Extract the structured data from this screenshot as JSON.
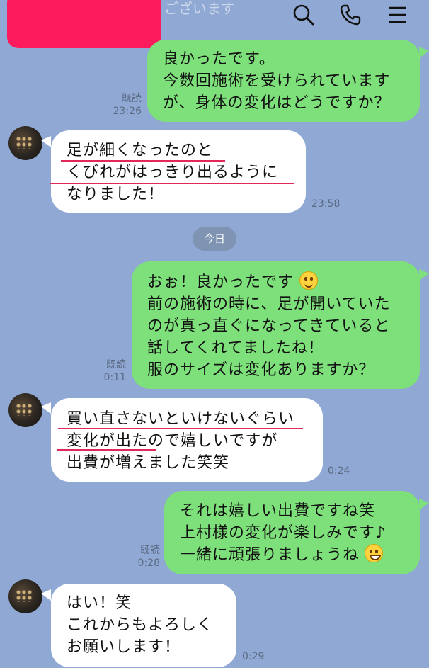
{
  "header": {
    "faded_text": "ございます",
    "icons": [
      "search-icon",
      "phone-icon",
      "menu-icon"
    ]
  },
  "messages": {
    "m1": {
      "side": "me",
      "lines": [
        "良かったです。",
        "今数回施術を受けられています",
        "が、身体の変化はどうですか？"
      ],
      "read": "既読",
      "time": "23:26"
    },
    "m2": {
      "side": "them",
      "lines": [
        "足が細くなったのと",
        "くびれがはっきり出るように",
        "なりました！"
      ],
      "time": "23:58"
    },
    "date_separator": "今日",
    "m3": {
      "side": "me",
      "lines": [
        "おぉ！良かったです",
        "前の施術の時に、足が開いていた",
        "のが真っ直ぐになってきていると",
        "話してくれてましたね！",
        "服のサイズは変化ありますか？"
      ],
      "read": "既読",
      "time": "0:11",
      "emoji": "smiling-face-emoji"
    },
    "m4": {
      "side": "them",
      "lines": [
        "買い直さないといけないぐらい",
        "変化が出たので嬉しいですが",
        "出費が増えました笑笑"
      ],
      "time": "0:24"
    },
    "m5": {
      "side": "me",
      "lines": [
        "それは嬉しい出費ですね笑",
        "上村様の変化が楽しみです♪",
        "一緒に頑張りましょうね"
      ],
      "read": "既読",
      "time": "0:28",
      "emoji": "grinning-face-emoji"
    },
    "m6": {
      "side": "them",
      "lines": [
        "はい！笑",
        "これからもよろしく",
        "お願いします！"
      ],
      "time": "0:29"
    }
  },
  "colors": {
    "background": "#8fa8d4",
    "my_bubble": "#7ee07a",
    "their_bubble": "#ffffff",
    "underline": "#e0285a",
    "redaction": "#fd1b5e"
  }
}
